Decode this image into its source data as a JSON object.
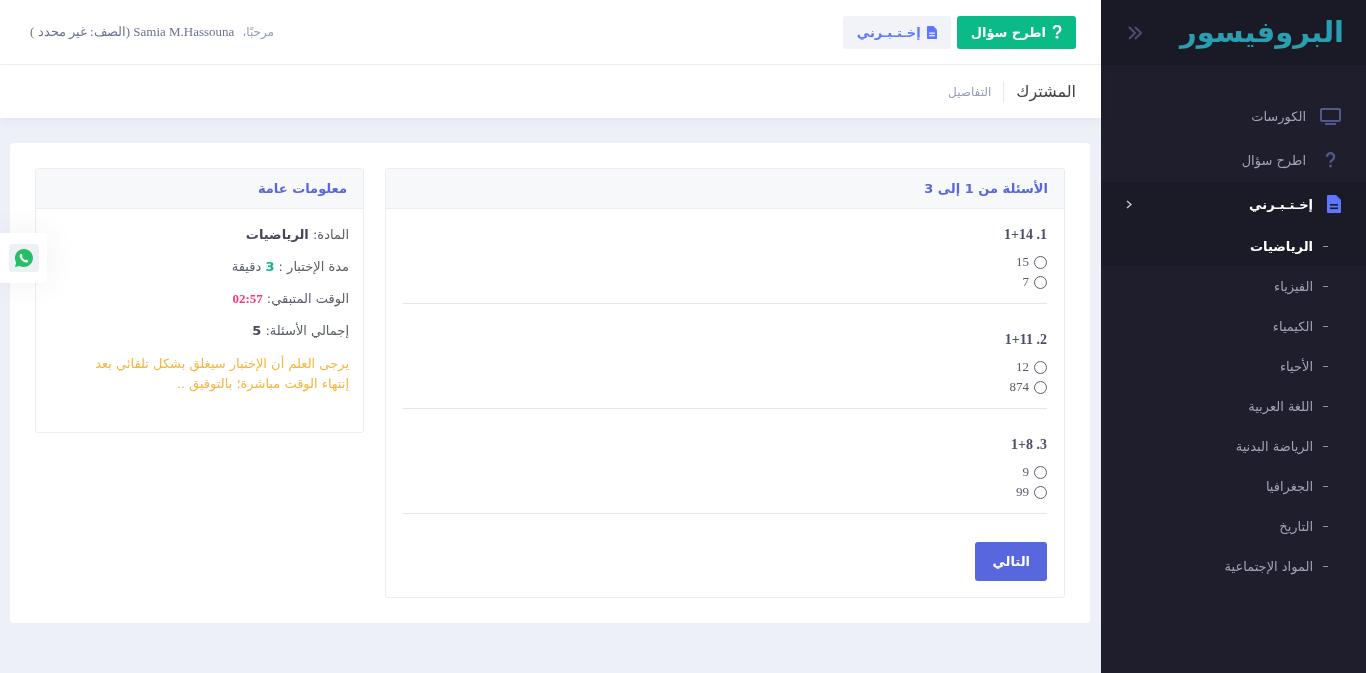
{
  "sidebar": {
    "logo": "البروفيسور",
    "menu": [
      {
        "label": "الكورسات",
        "selected": false
      },
      {
        "label": "اطرح سؤال",
        "selected": false
      },
      {
        "label": "إخـتـبـرني",
        "selected": true,
        "expanded": true,
        "children": [
          {
            "label": "الرياضيات",
            "selected": true
          },
          {
            "label": "الفيزياء",
            "selected": false
          },
          {
            "label": "الكيمياء",
            "selected": false
          },
          {
            "label": "الأحياء",
            "selected": false
          },
          {
            "label": "اللغة العربية",
            "selected": false
          },
          {
            "label": "الرياضة البدنية",
            "selected": false
          },
          {
            "label": "الجغرافيا",
            "selected": false
          },
          {
            "label": "التاريخ",
            "selected": false
          },
          {
            "label": "المواد الإجتماعية",
            "selected": false
          }
        ]
      }
    ]
  },
  "header": {
    "buttons": [
      {
        "label": "اطرح سؤال",
        "kind": "primary"
      },
      {
        "label": "إخـتـبـرني",
        "kind": "light"
      }
    ],
    "greeting": "مرحبًا،",
    "user": "Samia M.Hassouna (الصف: غير محدد )"
  },
  "subheader": {
    "title": "المشترك",
    "breadcrumb": "التفاصيل"
  },
  "questions_panel": {
    "title": "الأسئلة من 1 إلى 3",
    "questions": [
      {
        "number": "1.",
        "text": "1+14",
        "options": [
          {
            "label": "15",
            "selected": false
          },
          {
            "label": "7",
            "selected": false
          }
        ]
      },
      {
        "number": "2.",
        "text": "1+11",
        "options": [
          {
            "label": "12",
            "selected": false
          },
          {
            "label": "874",
            "selected": false
          }
        ]
      },
      {
        "number": "3.",
        "text": "1+8",
        "options": [
          {
            "label": "9",
            "selected": false
          },
          {
            "label": "99",
            "selected": false
          }
        ]
      }
    ],
    "next_button": "التالي"
  },
  "info_panel": {
    "title": "معلومات عامة",
    "lines": [
      {
        "text": "المادة: **الرياضيات**",
        "kind": "plain"
      },
      {
        "text": "مدة الإختبار : **3** دقيقة",
        "kind": "success"
      },
      {
        "text": "الوقت المتبقي: **02:57**",
        "kind": "danger"
      },
      {
        "text": "إجمالي الأسئلة: **5**",
        "kind": "plain"
      }
    ],
    "note": "يرجى العلم أن الإختبار سيغلق بشكل تلقائي بعد إنتهاء الوقت مباشرة؛ بالتوفيق .."
  }
}
